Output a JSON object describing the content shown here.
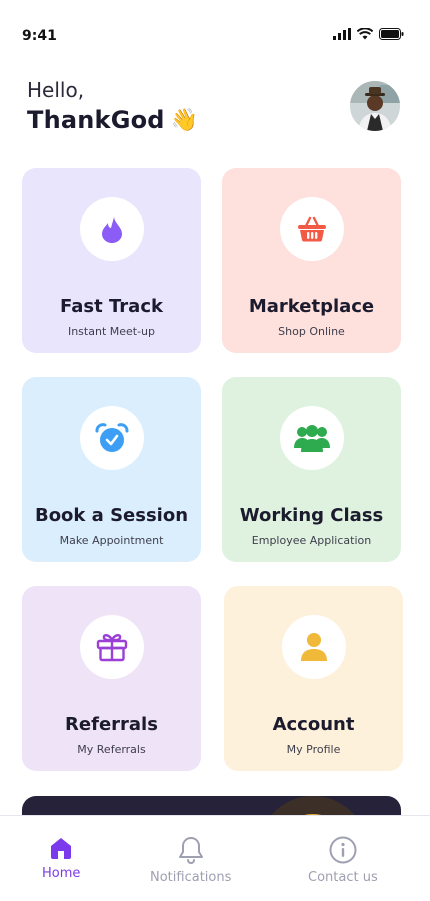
{
  "status": {
    "time": "9:41"
  },
  "greeting": {
    "hello": "Hello,",
    "name": "ThankGod",
    "emoji": "👋"
  },
  "cards": [
    {
      "title": "Fast Track",
      "subtitle": "Instant Meet-up",
      "icon": "flame-icon",
      "accent": "#8b5cf6"
    },
    {
      "title": "Marketplace",
      "subtitle": "Shop Online",
      "icon": "basket-icon",
      "accent": "#f25a45"
    },
    {
      "title": "Book a Session",
      "subtitle": "Make Appointment",
      "icon": "alarm-clock-icon",
      "accent": "#3d9ef5"
    },
    {
      "title": "Working Class",
      "subtitle": "Employee Application",
      "icon": "group-icon",
      "accent": "#2eaa4f"
    },
    {
      "title": "Referrals",
      "subtitle": "My Referrals",
      "icon": "gift-icon",
      "accent": "#9b3fd6"
    },
    {
      "title": "Account",
      "subtitle": "My Profile",
      "icon": "user-icon",
      "accent": "#f0b93a"
    }
  ],
  "nav": {
    "home": "Home",
    "notifications": "Notifications",
    "contact": "Contact us",
    "active_color": "#7c3aed",
    "inactive_color": "#9f9fb2"
  }
}
